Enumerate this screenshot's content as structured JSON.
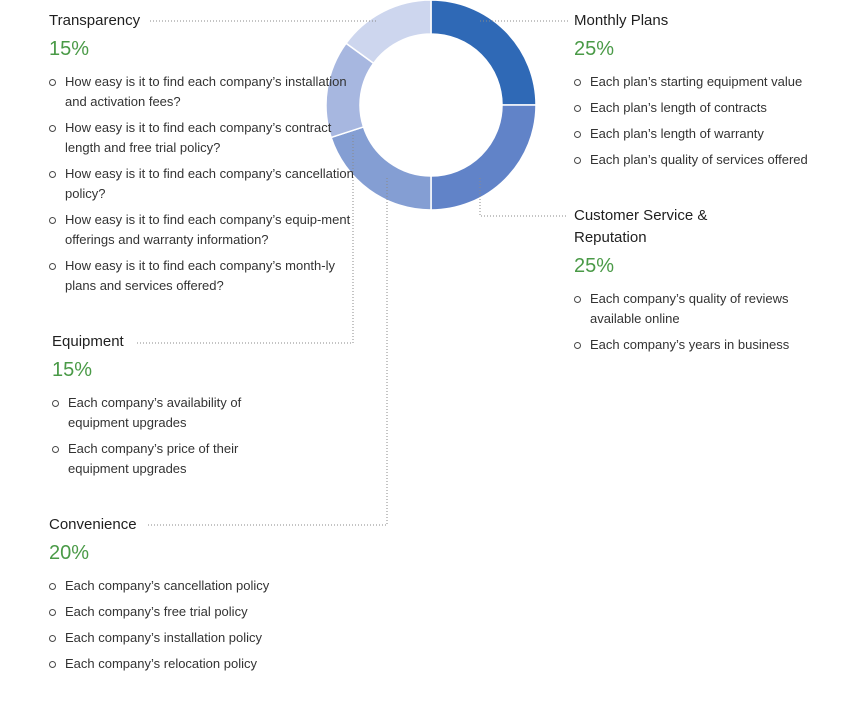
{
  "chart_data": {
    "type": "pie",
    "categories": [
      "Monthly Plans",
      "Customer Service & Reputation",
      "Convenience",
      "Equipment",
      "Transparency"
    ],
    "values": [
      25,
      25,
      20,
      15,
      15
    ],
    "colors": [
      "#2f69b6",
      "#6183c8",
      "#849ed3",
      "#a7b7e0",
      "#cdd6ee"
    ],
    "value_labels": [
      "25%",
      "25%",
      "20%",
      "15%",
      "15%"
    ],
    "title": "",
    "donut": true
  },
  "categories": {
    "monthly_plans": {
      "title": "Monthly Plans",
      "pct": "25%",
      "items": [
        "Each plan’s starting equipment value",
        "Each plan’s length of contracts",
        "Each plan’s length of warranty",
        "Each plan’s quality of services offered"
      ]
    },
    "customer_service": {
      "title_line1": "Customer Service &",
      "title_line2": "Reputation",
      "pct": "25%",
      "items": [
        "Each company’s quality of reviews available online",
        "Each company’s years in business"
      ]
    },
    "transparency": {
      "title": "Transparency",
      "pct": "15%",
      "items": [
        "How easy is it to find each company’s installation and activation fees?",
        "How easy is it to find each company’s contract length and free trial policy?",
        "How easy is it to find each company’s cancellation policy?",
        "How easy is it to find each company’s equip-ment offerings and warranty information?",
        "How easy is it to find each company’s month-ly plans and services offered?"
      ]
    },
    "equipment": {
      "title": "Equipment",
      "pct": "15%",
      "items": [
        "Each company’s availability of equipment upgrades",
        "Each company’s price of their equipment upgrades"
      ]
    },
    "convenience": {
      "title": "Convenience",
      "pct": "20%",
      "items": [
        "Each company’s cancellation policy",
        "Each company’s free trial policy",
        "Each company’s installation policy",
        "Each company’s relocation policy"
      ]
    }
  }
}
